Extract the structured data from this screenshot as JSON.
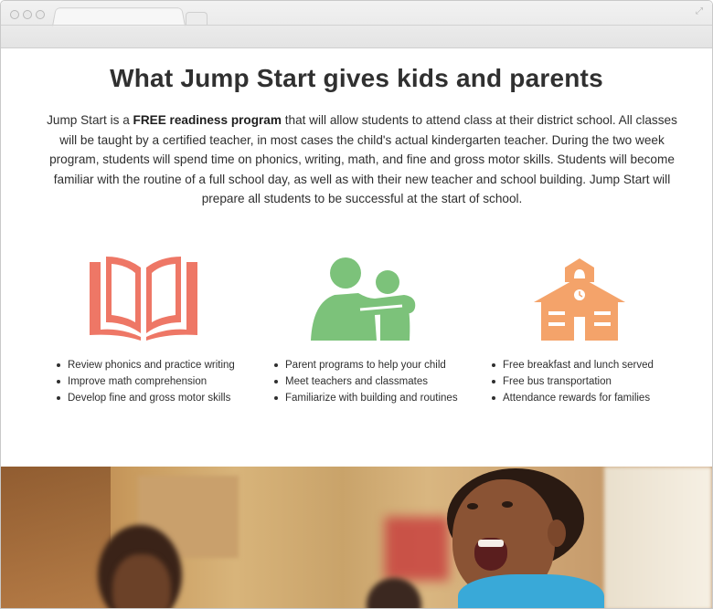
{
  "page": {
    "headline": "What Jump Start gives kids and parents",
    "intro": {
      "before": "Jump Start is a ",
      "bold": "FREE readiness program",
      "after": " that will allow students to attend class at their district school. All classes will be taught by a certified teacher, in most cases the child's actual kindergarten teacher. During the two week program, students will spend time on phonics, writing, math, and fine and gross motor skills. Students will become familiar with the routine of a full school day, as well as with their new teacher and school building. Jump Start will prepare all students to be successful at the start of school."
    }
  },
  "features": [
    {
      "icon": "open-book-icon",
      "color": "#ee7766",
      "bullets": [
        "Review phonics and practice writing",
        "Improve math comprehension",
        "Develop fine and gross motor skills"
      ]
    },
    {
      "icon": "parent-child-icon",
      "color": "#7cc27a",
      "bullets": [
        "Parent programs to help your child",
        "Meet teachers and classmates",
        "Familiarize with building and routines"
      ]
    },
    {
      "icon": "schoolhouse-icon",
      "color": "#f4a36a",
      "bullets": [
        "Free breakfast and lunch served",
        "Free bus transportation",
        "Attendance rewards for families"
      ]
    }
  ],
  "photo": {
    "subject": "smiling-child-photo"
  }
}
